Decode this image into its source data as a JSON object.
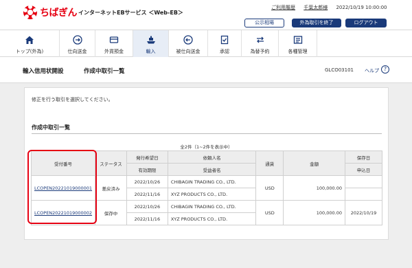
{
  "header": {
    "brand": "ちばぎん",
    "service": "インターネットEBサービス ＜Web-EB＞",
    "usage_history": "ご利用履歴",
    "user": "千葉太郎様",
    "timestamp": "2022/10/19 10:00:00",
    "btn_rates": "公示相場",
    "btn_end_fx": "外為取引を終了",
    "btn_logout": "ログアウト",
    "brand_color": "#e60012",
    "accent_color": "#1a3a7a"
  },
  "nav": [
    {
      "label": "トップ(外為)",
      "icon": "home-icon"
    },
    {
      "label": "仕向送金",
      "icon": "remittance-icon"
    },
    {
      "label": "外貨預金",
      "icon": "deposit-icon"
    },
    {
      "label": "輸入",
      "icon": "ship-icon"
    },
    {
      "label": "被仕向送金",
      "icon": "incoming-icon"
    },
    {
      "label": "承認",
      "icon": "approval-icon"
    },
    {
      "label": "為替予約",
      "icon": "exchange-icon"
    },
    {
      "label": "各種管理",
      "icon": "management-icon"
    }
  ],
  "titlebar": {
    "crumb1": "輸入信用状開設",
    "crumb2": "作成中取引一覧",
    "screen_id": "GLCO03101",
    "help": "ヘルプ",
    "help_glyph": "?"
  },
  "main": {
    "instruction": "修正を行う取引を選択してください。",
    "section_title": "作成中取引一覧",
    "count_text": "全2件（1~2件を表示中）",
    "table": {
      "headers": {
        "receipt_no": "受付番号",
        "status": "ステータス",
        "issue_date": "発行希望日",
        "expiry": "有効期限",
        "applicant": "依頼人名",
        "beneficiary": "受益者名",
        "currency": "通貨",
        "amount": "金額",
        "saved_date": "保存日",
        "applied_date": "申込日"
      },
      "rows": [
        {
          "receipt_no": "LCOPEN20221019000001",
          "status": "差戻済み",
          "issue_date": "2022/10/26",
          "expiry": "2022/11/16",
          "applicant": "CHIBAGIN TRADING CO., LTD.",
          "beneficiary": "XYZ PRODUCTS CO., LTD.",
          "currency": "USD",
          "amount": "100,000.00",
          "saved_date": "",
          "applied_date": ""
        },
        {
          "receipt_no": "LCOPEN20221019000002",
          "status": "保存中",
          "issue_date": "2022/10/26",
          "expiry": "2022/11/16",
          "applicant": "CHIBAGIN TRADING CO., LTD.",
          "beneficiary": "XYZ PRODUCTS CO., LTD.",
          "currency": "USD",
          "amount": "100,000.00",
          "saved_date": "2022/10/19",
          "applied_date": ""
        }
      ]
    }
  }
}
